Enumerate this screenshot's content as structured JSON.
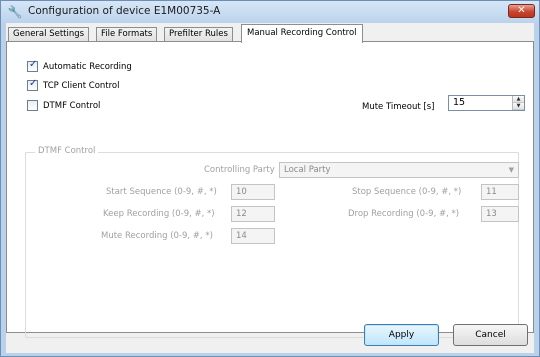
{
  "window": {
    "title": "Configuration of device E1M00735-A",
    "close_label": "✕"
  },
  "tabs": [
    {
      "label": "General Settings"
    },
    {
      "label": "File Formats"
    },
    {
      "label": "Prefilter Rules"
    },
    {
      "label": "Manual Recording Control"
    }
  ],
  "options": {
    "automatic_recording": {
      "label": "Automatic Recording",
      "checked": true
    },
    "tcp_client_control": {
      "label": "TCP Client Control",
      "checked": true
    },
    "dtmf_control": {
      "label": "DTMF Control",
      "checked": false
    }
  },
  "mute_timeout": {
    "label": "Mute Timeout [s]",
    "value": "15"
  },
  "dtmf_group": {
    "title": "DTMF Control",
    "controlling_party": {
      "label": "Controlling Party",
      "value": "Local Party"
    },
    "start_sequence": {
      "label": "Start Sequence (0-9, #, *)",
      "value": "10"
    },
    "stop_sequence": {
      "label": "Stop Sequence (0-9, #, *)",
      "value": "11"
    },
    "keep_recording": {
      "label": "Keep Recording (0-9, #, *)",
      "value": "12"
    },
    "drop_recording": {
      "label": "Drop Recording (0-9, #, *)",
      "value": "13"
    },
    "mute_recording": {
      "label": "Mute Recording (0-9, #, *)",
      "value": "14"
    }
  },
  "buttons": {
    "apply": "Apply",
    "cancel": "Cancel"
  }
}
